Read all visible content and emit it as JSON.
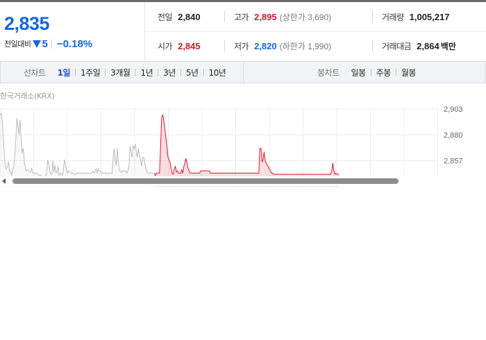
{
  "quote": {
    "price": "2,835",
    "change_label": "전일대비",
    "change_value": "5",
    "change_rate": "−0.18%",
    "stats": {
      "prev": {
        "label": "전일",
        "value": "2,840"
      },
      "open": {
        "label": "시가",
        "value": "2,845"
      },
      "high": {
        "label": "고가",
        "value": "2,895",
        "sub": "(상한가 3,690)"
      },
      "low": {
        "label": "저가",
        "value": "2,820",
        "sub": "(하한가 1,990)"
      },
      "volume": {
        "label": "거래량",
        "value": "1,005,217"
      },
      "amount": {
        "label": "거래대금",
        "value": "2,864",
        "unit": "백만"
      }
    }
  },
  "toolbar": {
    "line_title": "선차트",
    "line_tabs": [
      "1일",
      "1주일",
      "3개월",
      "1년",
      "3년",
      "5년",
      "10년"
    ],
    "line_active": "1일",
    "candle_title": "봉차트",
    "candle_tabs": [
      "일봉",
      "주봉",
      "월봉"
    ]
  },
  "chart": {
    "source": "한국거래소(KRX)",
    "colors": {
      "up": "#e0152a",
      "flat": "#bbbbbb",
      "grid": "#ececec"
    }
  },
  "chart_data": {
    "type": "line",
    "ylim": [
      2834,
      2903
    ],
    "y_ticks": [
      "2,903",
      "2,880",
      "2,857"
    ],
    "y_tick_values": [
      2903,
      2880,
      2857
    ],
    "series": [
      {
        "color": "#bbbbbb",
        "values": [
          2898,
          2899,
          2894,
          2880,
          2864,
          2852,
          2850,
          2852,
          2856,
          2848,
          2848,
          2844,
          2850,
          2852,
          2862,
          2876,
          2895,
          2888,
          2880,
          2893,
          2877,
          2864,
          2868,
          2856,
          2852,
          2848,
          2849,
          2848,
          2847,
          2847,
          2850,
          2846,
          2846,
          2846,
          2846,
          2846,
          2845,
          2844,
          2844,
          2844,
          2840,
          2840,
          2840,
          2844,
          2846,
          2857,
          2856,
          2848,
          2845,
          2845,
          2857,
          2847,
          2853,
          2846,
          2847,
          2852,
          2844,
          2846,
          2845,
          2844,
          2848,
          2858,
          2854,
          2848,
          2846,
          2848,
          2848,
          2846,
          2846,
          2846,
          2845,
          2845,
          2845,
          2846,
          2846,
          2846,
          2846,
          2846,
          2846,
          2846,
          2846,
          2846,
          2846,
          2846,
          2846,
          2846,
          2846,
          2846,
          2848,
          2846,
          2848,
          2850,
          2846,
          2850,
          2848,
          2848,
          2846,
          2846,
          2846,
          2846,
          2846,
          2846,
          2846,
          2846,
          2846,
          2846,
          2846,
          2858,
          2868,
          2857,
          2853,
          2868,
          2856,
          2848,
          2848,
          2847,
          2848,
          2848,
          2848,
          2848,
          2846,
          2848,
          2852,
          2870,
          2865,
          2860,
          2870,
          2868,
          2872,
          2865,
          2860,
          2868,
          2862,
          2858,
          2852,
          2860,
          2860,
          2855,
          2850,
          2848,
          2846,
          2846,
          2846,
          2846,
          2846,
          2846
        ]
      },
      {
        "color": "#e0152a",
        "values": [
          2846,
          2844,
          2846,
          2846,
          2846,
          2846,
          2870,
          2895,
          2898,
          2893,
          2885,
          2878,
          2870,
          2860,
          2858,
          2855,
          2850,
          2846,
          2845,
          2850,
          2852,
          2847,
          2848,
          2846,
          2846,
          2846,
          2849,
          2846,
          2852,
          2855,
          2859,
          2855,
          2850,
          2848,
          2846,
          2846,
          2846,
          2846,
          2846,
          2846,
          2846,
          2846,
          2846,
          2846,
          2848,
          2848,
          2848,
          2848,
          2848,
          2848,
          2848,
          2848,
          2848,
          2846,
          2846,
          2846,
          2846,
          2846,
          2846,
          2846,
          2846,
          2846,
          2846,
          2846,
          2846,
          2846,
          2846,
          2846,
          2846,
          2846,
          2846,
          2846,
          2846,
          2846,
          2846,
          2846,
          2846,
          2846,
          2846,
          2846,
          2846,
          2846,
          2846,
          2846,
          2846,
          2846,
          2846,
          2846,
          2846,
          2846,
          2846,
          2846,
          2846,
          2846,
          2846,
          2846,
          2846,
          2846,
          2846,
          2846,
          2868,
          2868,
          2856,
          2858,
          2865,
          2857,
          2855,
          2853,
          2852,
          2850,
          2848,
          2846,
          2846,
          2845,
          2845,
          2845,
          2845,
          2845,
          2845,
          2845,
          2845,
          2845,
          2845,
          2845,
          2845,
          2845,
          2845,
          2845,
          2845,
          2845,
          2845,
          2845,
          2845,
          2845,
          2845,
          2845,
          2845,
          2845,
          2845,
          2845,
          2845,
          2845,
          2845,
          2845,
          2845,
          2845,
          2845,
          2845,
          2845,
          2845,
          2845,
          2845,
          2845,
          2845,
          2845,
          2845,
          2845,
          2845,
          2845,
          2845,
          2845,
          2845,
          2845,
          2845,
          2845,
          2845,
          2845,
          2845,
          2848,
          2855,
          2848,
          2845,
          2846,
          2845,
          2845,
          2845
        ]
      }
    ]
  }
}
